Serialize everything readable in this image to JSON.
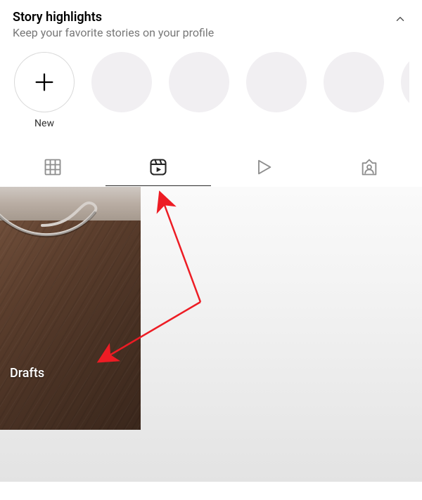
{
  "highlights": {
    "title": "Story highlights",
    "subtitle": "Keep your favorite stories on your profile",
    "new_label": "New",
    "placeholder_count": 5
  },
  "tabs": {
    "items": [
      "grid",
      "reels",
      "play",
      "tagged"
    ],
    "active_index": 1
  },
  "content": {
    "tiles": [
      {
        "label": "Drafts"
      }
    ]
  },
  "colors": {
    "annotation": "#ed1c24"
  }
}
